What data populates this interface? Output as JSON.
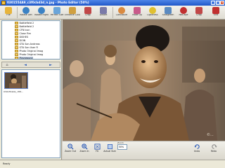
{
  "window": {
    "title": "0301554A9_c3f0cbd3d_n.jpg - Photo Editor (50%)",
    "min": "_",
    "max": "□",
    "close": "×"
  },
  "toolbar": {
    "tools": [
      {
        "name": "file",
        "label": "File",
        "icon": "folder-icon",
        "color": "#e7b43c"
      },
      {
        "name": "rotate-left",
        "label": "Rotate Left",
        "icon": "rotate-left-icon",
        "color": "#3b82c4"
      },
      {
        "name": "rotate-right",
        "label": "Rotate Right",
        "icon": "rotate-right-icon",
        "color": "#3b82c4"
      },
      {
        "name": "perfect-size",
        "label": "Perfect Size",
        "icon": "resize-icon",
        "color": "#6aa5d9"
      },
      {
        "name": "enhance-color",
        "label": "Enhance Color",
        "icon": "palette-icon",
        "color": "#d0a040"
      },
      {
        "name": "crop-square",
        "label": "Crop",
        "icon": "crop-icon",
        "color": "#c04848"
      },
      {
        "name": "distort",
        "label": "Distort",
        "icon": "distort-icon",
        "color": "#7a7aa8"
      },
      {
        "name": "caricature",
        "label": "Caricature",
        "icon": "caricature-icon",
        "color": "#d98a40"
      },
      {
        "name": "makeup",
        "label": "Make Up",
        "icon": "makeup-icon",
        "color": "#c85a8a"
      },
      {
        "name": "lightness",
        "label": "Lightness",
        "icon": "sun-icon",
        "color": "#e0c030"
      },
      {
        "name": "straighten",
        "label": "Straighten",
        "icon": "straighten-icon",
        "color": "#5a8ac0"
      },
      {
        "name": "redeye",
        "label": "Red-eye",
        "icon": "eye-icon",
        "color": "#c03030"
      },
      {
        "name": "crop",
        "label": "Crop",
        "icon": "crop-icon",
        "color": "#c04848"
      },
      {
        "name": "exit",
        "label": "Exit",
        "icon": "exit-icon",
        "color": "#c03030"
      }
    ]
  },
  "tree": {
    "items": [
      {
        "label": "Battlefield 2"
      },
      {
        "label": "Battlefield 2"
      },
      {
        "label": "CFN Icon"
      },
      {
        "label": "Close Fire"
      },
      {
        "label": "DISHES"
      },
      {
        "label": "DOIN"
      },
      {
        "label": "GTA San Andreas"
      },
      {
        "label": "GTA San User Fi"
      },
      {
        "label": "Photo Original Imag"
      },
      {
        "label": "Photo Original Imag"
      },
      {
        "label": "Playground"
      }
    ]
  },
  "nav": {
    "back": "◄",
    "forward": "►",
    "home": "⌂"
  },
  "thumbnail": {
    "caption": "0301554A9_c3f0..."
  },
  "bottom": {
    "tools": [
      {
        "name": "zoom-out",
        "label": "Zoom Out",
        "icon": "zoom-out-icon"
      },
      {
        "name": "zoom-in",
        "label": "Zoom In",
        "icon": "zoom-in-icon"
      },
      {
        "name": "fit",
        "label": "Fit",
        "icon": "fit-icon"
      },
      {
        "name": "actual-size",
        "label": "Actual Size",
        "icon": "actual-size-icon"
      },
      {
        "name": "undo",
        "label": "Undo",
        "icon": "undo-icon"
      },
      {
        "name": "redo",
        "label": "Redo",
        "icon": "redo-icon"
      }
    ],
    "zoom_label": "Zoom",
    "zoom_value": "50%"
  },
  "image": {
    "watermark": "©..."
  },
  "statusbar": {
    "text": "Ready"
  },
  "colors": {
    "titlebar": "#2a62d6",
    "panel": "#ece9d8",
    "photo_tone": "#8a6a4a"
  }
}
